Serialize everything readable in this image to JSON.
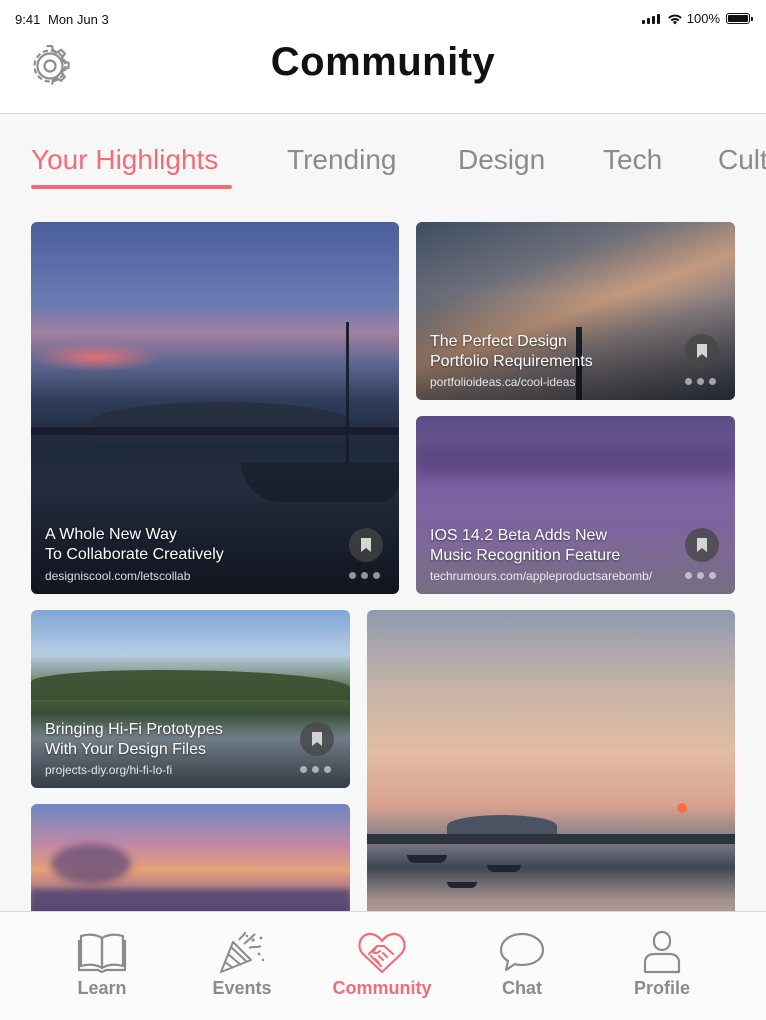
{
  "status_bar": {
    "time": "9:41",
    "date": "Mon Jun 3",
    "battery": "100%"
  },
  "header": {
    "title": "Community",
    "settings_icon": "gear-icon"
  },
  "tabs": [
    {
      "label": "Your Highlights",
      "active": true
    },
    {
      "label": "Trending",
      "active": false
    },
    {
      "label": "Design",
      "active": false
    },
    {
      "label": "Tech",
      "active": false
    },
    {
      "label": "Cult",
      "active": false
    }
  ],
  "cards": [
    {
      "title_line1": "A Whole New Way",
      "title_line2": "To Collaborate Creatively",
      "url": "designiscool.com/letscollab"
    },
    {
      "title_line1": "The Perfect Design",
      "title_line2": "Portfolio Requirements",
      "url": "portfolioideas.ca/cool-ideas"
    },
    {
      "title_line1": "IOS 14.2 Beta Adds New",
      "title_line2": "Music Recognition Feature",
      "url": "techrumours.com/appleproductsarebomb/"
    },
    {
      "title_line1": "Bringing Hi-Fi Prototypes",
      "title_line2": "With Your Design Files",
      "url": "projects-diy.org/hi-fi-lo-fi"
    }
  ],
  "tabbar": [
    {
      "label": "Learn",
      "icon": "book-icon",
      "active": false
    },
    {
      "label": "Events",
      "icon": "party-popper-icon",
      "active": false
    },
    {
      "label": "Community",
      "icon": "handshake-heart-icon",
      "active": true
    },
    {
      "label": "Chat",
      "icon": "chat-bubble-icon",
      "active": false
    },
    {
      "label": "Profile",
      "icon": "person-icon",
      "active": false
    }
  ],
  "colors": {
    "accent": "#f36c78",
    "inactive": "#8b8b8b"
  }
}
